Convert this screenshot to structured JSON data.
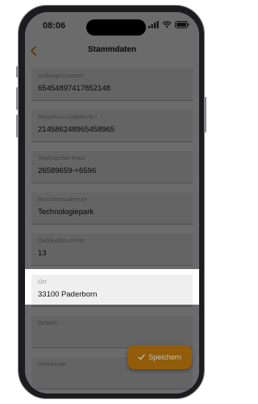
{
  "status_bar": {
    "time": "08:06"
  },
  "nav": {
    "title": "Stammdaten"
  },
  "form": {
    "fields": [
      {
        "label": "Auftragsnummer*",
        "value": "65454897417852148"
      },
      {
        "label": "Anschluss-Objekt-Nr.*",
        "value": "214586248965458965"
      },
      {
        "label": "Technischer Platz",
        "value": "26589659-+6596"
      },
      {
        "label": "Anschlussadresse",
        "value": "Technologiepark"
      },
      {
        "label": "Gebäudenummer",
        "value": "13"
      },
      {
        "label": "Ort",
        "value": "33100 Paderborn"
      },
      {
        "label": "Ortsteil",
        "value": ""
      },
      {
        "label": "Gemeinde",
        "value": ""
      }
    ]
  },
  "save_button": {
    "label": "Speichern"
  },
  "colors": {
    "accent": "#c27d0e",
    "overlay": "rgba(0,0,0,0.58)"
  },
  "icons": [
    "chevron-left-icon",
    "signal-icon",
    "wifi-icon",
    "battery-icon",
    "checkmark-icon"
  ]
}
